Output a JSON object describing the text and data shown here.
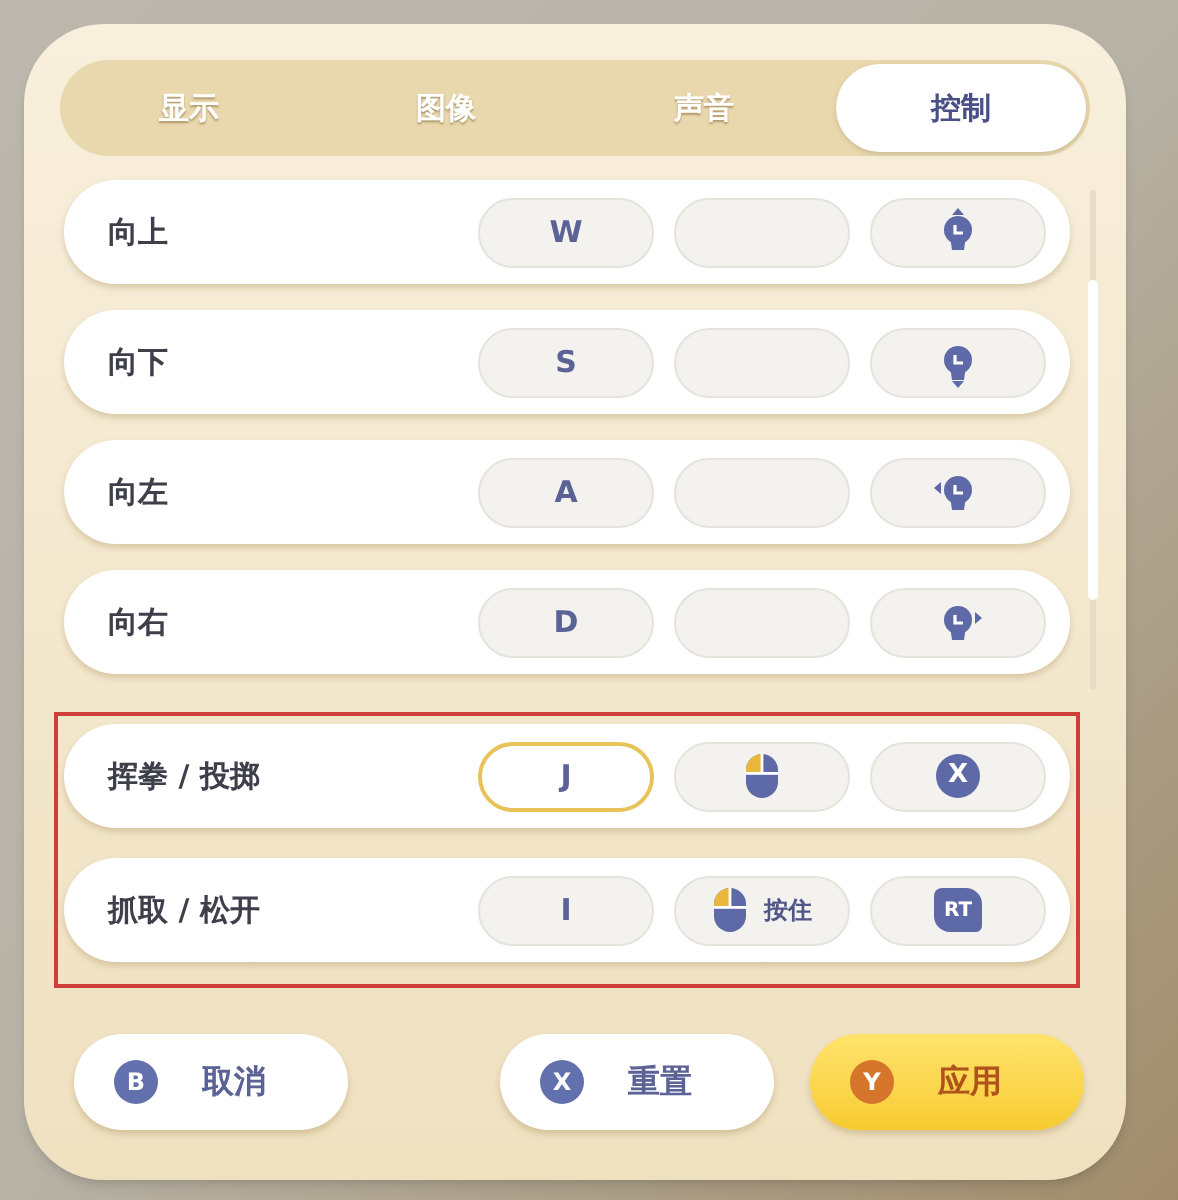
{
  "tabs": [
    {
      "label": "显示",
      "selected": false
    },
    {
      "label": "图像",
      "selected": false
    },
    {
      "label": "声音",
      "selected": false
    },
    {
      "label": "控制",
      "selected": true
    }
  ],
  "rows": [
    {
      "label": "向上",
      "highlighted": false,
      "bindings": [
        {
          "kind": "key",
          "text": "W",
          "focused": false
        },
        {
          "kind": "empty",
          "focused": false
        },
        {
          "kind": "stick-up",
          "focused": false
        }
      ]
    },
    {
      "label": "向下",
      "highlighted": false,
      "bindings": [
        {
          "kind": "key",
          "text": "S",
          "focused": false
        },
        {
          "kind": "empty",
          "focused": false
        },
        {
          "kind": "stick-down",
          "focused": false
        }
      ]
    },
    {
      "label": "向左",
      "highlighted": false,
      "bindings": [
        {
          "kind": "key",
          "text": "A",
          "focused": false
        },
        {
          "kind": "empty",
          "focused": false
        },
        {
          "kind": "stick-left",
          "focused": false
        }
      ]
    },
    {
      "label": "向右",
      "highlighted": false,
      "bindings": [
        {
          "kind": "key",
          "text": "D",
          "focused": false
        },
        {
          "kind": "empty",
          "focused": false
        },
        {
          "kind": "stick-right",
          "focused": false
        }
      ]
    },
    {
      "label": "挥拳 / 投掷",
      "highlighted": true,
      "bindings": [
        {
          "kind": "key",
          "text": "J",
          "focused": true
        },
        {
          "kind": "mouse",
          "focused": false
        },
        {
          "kind": "pad-button",
          "text": "X",
          "focused": false
        }
      ]
    },
    {
      "label": "抓取 / 松开",
      "highlighted": true,
      "bindings": [
        {
          "kind": "key",
          "text": "I",
          "focused": false
        },
        {
          "kind": "mouse",
          "text": "按住",
          "focused": false
        },
        {
          "kind": "trigger",
          "text": "RT",
          "focused": false
        }
      ]
    }
  ],
  "footer_buttons": [
    {
      "badge": "B",
      "label": "取消",
      "kind": "default"
    },
    {
      "badge": "X",
      "label": "重置",
      "kind": "default"
    },
    {
      "badge": "Y",
      "label": "应用",
      "kind": "primary"
    }
  ]
}
